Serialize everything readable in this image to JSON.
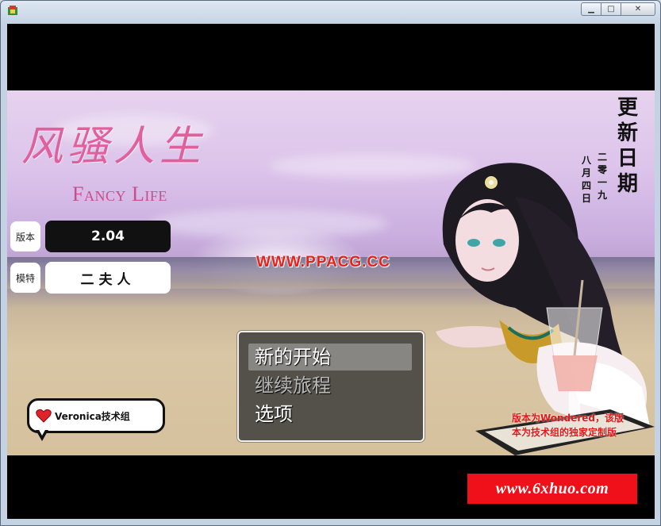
{
  "window": {
    "title": "",
    "controls": {
      "minimize": "▁",
      "maximize": "□",
      "close": "✕"
    }
  },
  "game": {
    "title_cn": "风骚人生",
    "title_en": "Fancy Life",
    "info": {
      "version_label": "版本",
      "version_value": "2.04",
      "model_label": "模特",
      "model_value": "二夫人"
    },
    "update": {
      "title_chars": [
        "更",
        "新",
        "日",
        "期"
      ],
      "date_col1": "二零一九",
      "date_col2": "八月四日"
    },
    "watermark": "WWW.PPACG.CC",
    "menu": {
      "items": [
        {
          "label": "新的开始",
          "selected": true
        },
        {
          "label": "继续旅程",
          "selected": false
        },
        {
          "label": "选项",
          "selected": false
        }
      ]
    },
    "bubble_text": "Veronica技术组",
    "credit_lines": [
      "版本为Wondered，该版",
      "本为技术组的独家定制版"
    ],
    "banner": "www.6xhuo.com"
  },
  "colors": {
    "title_pink": "#e0609e",
    "watermark_red": "#e8201b",
    "banner_red": "#f0101a"
  }
}
